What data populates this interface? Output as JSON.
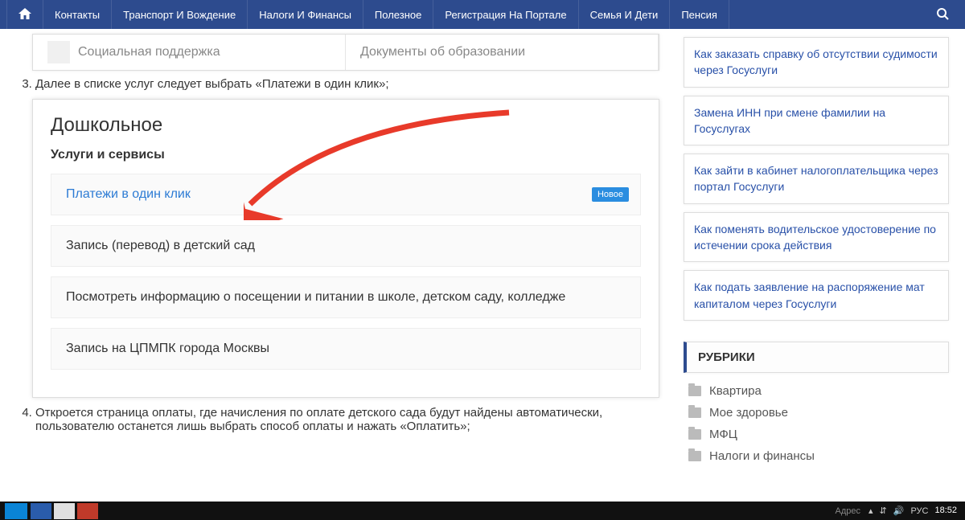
{
  "nav": {
    "items": [
      "Контакты",
      "Транспорт И Вождение",
      "Налоги И Финансы",
      "Полезное",
      "Регистрация На Портале",
      "Семья И Дети",
      "Пенсия"
    ]
  },
  "frag_tabs": {
    "left": "Социальная поддержка",
    "right": "Документы об образовании"
  },
  "step3": "Далее в списке услуг следует выбрать «Платежи в один клик»;",
  "step4": "Откроется страница оплаты, где начисления по оплате детского сада будут найдены автоматически, пользователю останется лишь выбрать способ оплаты и нажать «Оплатить»;",
  "card": {
    "title": "Дошкольное",
    "sub": "Услуги и сервисы",
    "services": [
      {
        "label": "Платежи в один клик",
        "badge": "Новое",
        "highlight": true
      },
      {
        "label": "Запись (перевод) в детский сад"
      },
      {
        "label": "Посмотреть информацию о посещении и питании в школе, детском саду, колледже"
      },
      {
        "label": "Запись на ЦПМПК города Москвы"
      }
    ]
  },
  "sidebar": {
    "links": [
      "Как заказать справку об отсутствии судимости через Госуслуги",
      "Замена ИНН при смене фамилии на Госуслугах",
      "Как зайти в кабинет налогоплательщика через портал Госуслуги",
      "Как поменять водительское удостоверение по истечении срока действия",
      "Как подать заявление на распоряжение мат капиталом через Госуслуги"
    ],
    "header": "РУБРИКИ",
    "rubrics": [
      "Квартира",
      "Мое здоровье",
      "МФЦ",
      "Налоги и финансы"
    ]
  },
  "taskbar": {
    "addr_label": "Адрес",
    "lang": "РУС",
    "time": "18:52"
  }
}
